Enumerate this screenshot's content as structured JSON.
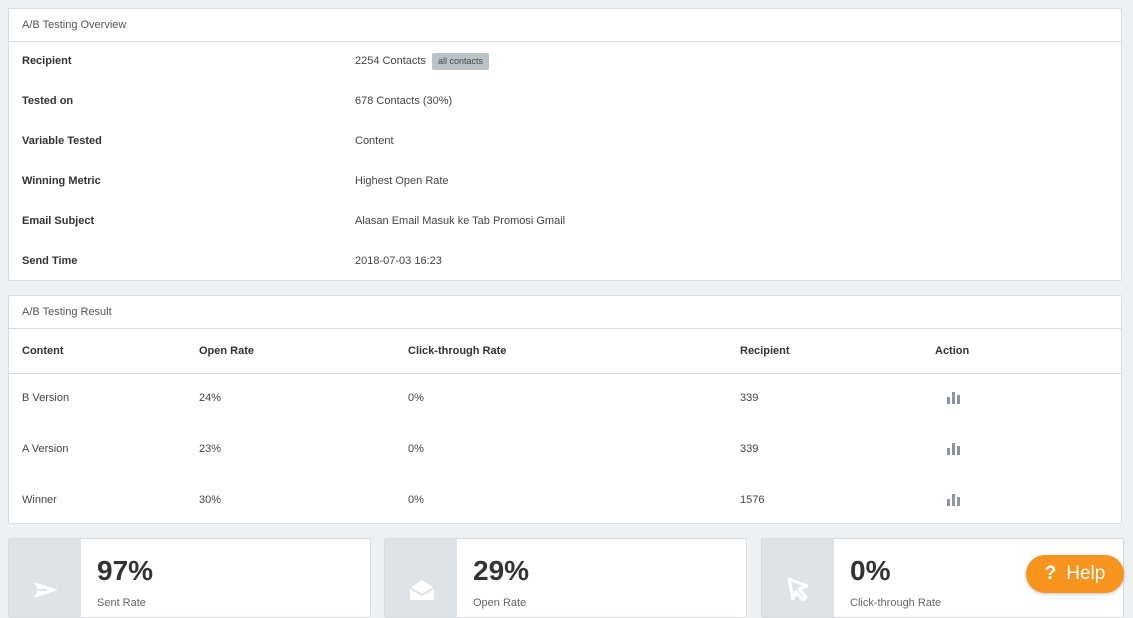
{
  "overview": {
    "title": "A/B Testing Overview",
    "rows": [
      {
        "label": "Recipient",
        "value": "2254 Contacts",
        "badge": "all contacts"
      },
      {
        "label": "Tested on",
        "value": "678 Contacts (30%)"
      },
      {
        "label": "Variable Tested",
        "value": "Content"
      },
      {
        "label": "Winning Metric",
        "value": "Highest Open Rate"
      },
      {
        "label": "Email Subject",
        "value": "Alasan Email Masuk ke Tab Promosi Gmail"
      },
      {
        "label": "Send Time",
        "value": "2018-07-03 16:23"
      }
    ]
  },
  "result": {
    "title": "A/B Testing Result",
    "headers": [
      "Content",
      "Open Rate",
      "Click-through Rate",
      "Recipient",
      "Action"
    ],
    "rows": [
      {
        "content": "B Version",
        "open_rate": "24%",
        "ctr": "0%",
        "recipient": "339",
        "action_icon": "bar-chart-icon"
      },
      {
        "content": "A Version",
        "open_rate": "23%",
        "ctr": "0%",
        "recipient": "339",
        "action_icon": "bar-chart-icon"
      },
      {
        "content": "Winner",
        "open_rate": "30%",
        "ctr": "0%",
        "recipient": "1576",
        "action_icon": "bar-chart-icon"
      }
    ]
  },
  "stats": [
    {
      "value": "97%",
      "label": "Sent Rate",
      "icon": "paper-plane-icon"
    },
    {
      "value": "29%",
      "label": "Open Rate",
      "icon": "open-envelope-icon"
    },
    {
      "value": "0%",
      "label": "Click-through Rate",
      "icon": "cursor-icon"
    }
  ],
  "help": {
    "icon": "?",
    "label": "Help"
  },
  "colors": {
    "accent": "#f7941d",
    "icon_gray": "#8a969c",
    "border": "#d5dde3",
    "background": "#eef1f4"
  }
}
